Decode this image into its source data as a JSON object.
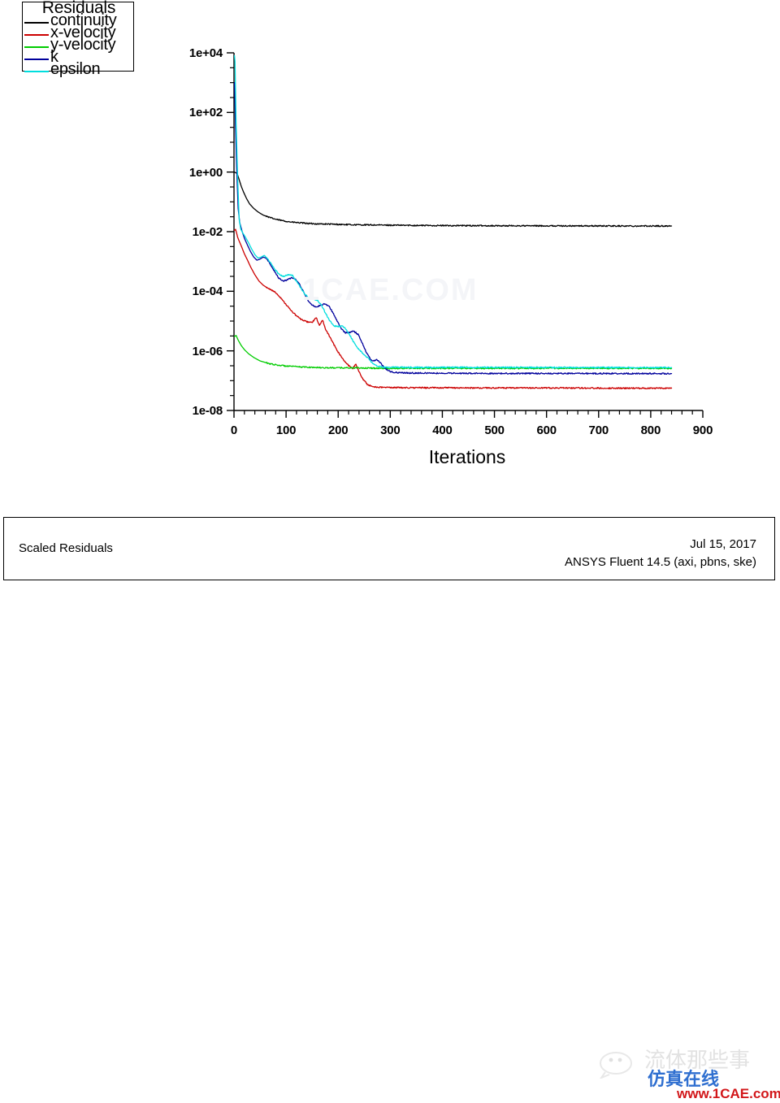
{
  "legend": {
    "title": "Residuals",
    "items": [
      {
        "label": "continuity",
        "color": "#000000"
      },
      {
        "label": "x-velocity",
        "color": "#cc0000"
      },
      {
        "label": "y-velocity",
        "color": "#00cc00"
      },
      {
        "label": "k",
        "color": "#00009c"
      },
      {
        "label": "epsilon",
        "color": "#00dede"
      }
    ]
  },
  "axes": {
    "y_labels": [
      "1e+04",
      "1e+02",
      "1e+00",
      "1e-02",
      "1e-04",
      "1e-06",
      "1e-08"
    ],
    "x_labels": [
      "0",
      "100",
      "200",
      "300",
      "400",
      "500",
      "600",
      "700",
      "800",
      "900"
    ],
    "x_title": "Iterations"
  },
  "info_bar": {
    "title": "Scaled Residuals",
    "date": "Jul 15, 2017",
    "solver": "ANSYS Fluent 14.5 (axi, pbns, ske)"
  },
  "watermarks": {
    "center": "1CAE.COM",
    "corner_cn_gray": "流体那些事",
    "corner_cn_blue": "仿真在线",
    "corner_url": "www.1CAE.com"
  },
  "chart_data": {
    "type": "line",
    "title": "Scaled Residuals",
    "xlabel": "Iterations",
    "ylabel": "",
    "xlim": [
      0,
      900
    ],
    "ylim": [
      1e-08,
      10000.0
    ],
    "yscale": "log",
    "grid": false,
    "legend_position": "top-left",
    "x_ticks": [
      0,
      100,
      200,
      300,
      400,
      500,
      600,
      700,
      800,
      900
    ],
    "x_minor_tick_step": 20,
    "y_ticks": [
      10000.0,
      100.0,
      1.0,
      0.01,
      0.0001,
      1e-06,
      1e-08
    ],
    "y_minor_ticks_per_decade_pair": 3,
    "data_x_end": 840,
    "series": [
      {
        "name": "continuity",
        "color": "#000000",
        "points": [
          [
            1,
            1.0
          ],
          [
            3,
            0.95
          ],
          [
            6,
            0.9
          ],
          [
            10,
            0.55
          ],
          [
            14,
            0.33
          ],
          [
            18,
            0.22
          ],
          [
            24,
            0.13
          ],
          [
            30,
            0.085
          ],
          [
            38,
            0.06
          ],
          [
            46,
            0.046
          ],
          [
            56,
            0.036
          ],
          [
            68,
            0.03
          ],
          [
            80,
            0.026
          ],
          [
            95,
            0.023
          ],
          [
            110,
            0.021
          ],
          [
            130,
            0.0195
          ],
          [
            150,
            0.0185
          ],
          [
            175,
            0.018
          ],
          [
            200,
            0.0175
          ],
          [
            230,
            0.017
          ],
          [
            260,
            0.0168
          ],
          [
            300,
            0.0165
          ],
          [
            350,
            0.0162
          ],
          [
            400,
            0.016
          ],
          [
            450,
            0.0159
          ],
          [
            500,
            0.0158
          ],
          [
            550,
            0.0157
          ],
          [
            600,
            0.0157
          ],
          [
            650,
            0.0156
          ],
          [
            700,
            0.0156
          ],
          [
            750,
            0.0155
          ],
          [
            800,
            0.0155
          ],
          [
            840,
            0.0155
          ]
        ]
      },
      {
        "name": "x-velocity",
        "color": "#cc0000",
        "points": [
          [
            1,
            0.011
          ],
          [
            3,
            0.012
          ],
          [
            5,
            0.009
          ],
          [
            7,
            0.0065
          ],
          [
            10,
            0.0048
          ],
          [
            14,
            0.0033
          ],
          [
            20,
            0.0018
          ],
          [
            26,
            0.0011
          ],
          [
            32,
            0.00065
          ],
          [
            40,
            0.00036
          ],
          [
            48,
            0.00022
          ],
          [
            56,
            0.00016
          ],
          [
            64,
            0.00013
          ],
          [
            72,
            0.00011
          ],
          [
            80,
            9e-05
          ],
          [
            90,
            6e-05
          ],
          [
            100,
            3.6e-05
          ],
          [
            110,
            2.2e-05
          ],
          [
            120,
            1.5e-05
          ],
          [
            130,
            1.1e-05
          ],
          [
            140,
            9.5e-06
          ],
          [
            150,
            9e-06
          ],
          [
            158,
            1.3e-05
          ],
          [
            164,
            7e-06
          ],
          [
            170,
            1.1e-05
          ],
          [
            176,
            5e-06
          ],
          [
            184,
            3e-06
          ],
          [
            192,
            1.6e-06
          ],
          [
            200,
            9e-07
          ],
          [
            210,
            5e-07
          ],
          [
            220,
            3.2e-07
          ],
          [
            228,
            2.6e-07
          ],
          [
            234,
            3.6e-07
          ],
          [
            240,
            2e-07
          ],
          [
            248,
            1.1e-07
          ],
          [
            256,
            7.5e-08
          ],
          [
            266,
            6.3e-08
          ],
          [
            280,
            6e-08
          ],
          [
            300,
            5.9e-08
          ],
          [
            340,
            5.8e-08
          ],
          [
            400,
            5.8e-08
          ],
          [
            460,
            5.7e-08
          ],
          [
            520,
            5.7e-08
          ],
          [
            580,
            5.7e-08
          ],
          [
            650,
            5.7e-08
          ],
          [
            720,
            5.6e-08
          ],
          [
            790,
            5.6e-08
          ],
          [
            840,
            5.6e-08
          ]
        ]
      },
      {
        "name": "y-velocity",
        "color": "#00cc00",
        "points": [
          [
            1,
            3e-06
          ],
          [
            4,
            3.3e-06
          ],
          [
            8,
            2.3e-06
          ],
          [
            14,
            1.5e-06
          ],
          [
            20,
            1.1e-06
          ],
          [
            28,
            8e-07
          ],
          [
            38,
            6e-07
          ],
          [
            50,
            4.6e-07
          ],
          [
            64,
            3.9e-07
          ],
          [
            80,
            3.4e-07
          ],
          [
            100,
            3.1e-07
          ],
          [
            125,
            2.9e-07
          ],
          [
            150,
            2.8e-07
          ],
          [
            180,
            2.7e-07
          ],
          [
            215,
            2.7e-07
          ],
          [
            250,
            2.65e-07
          ],
          [
            290,
            2.6e-07
          ],
          [
            340,
            2.6e-07
          ],
          [
            400,
            2.6e-07
          ],
          [
            460,
            2.6e-07
          ],
          [
            530,
            2.6e-07
          ],
          [
            600,
            2.6e-07
          ],
          [
            680,
            2.6e-07
          ],
          [
            760,
            2.6e-07
          ],
          [
            840,
            2.6e-07
          ]
        ]
      },
      {
        "name": "k",
        "color": "#00009c",
        "points": [
          [
            1,
            1000.0
          ],
          [
            3,
            30.0
          ],
          [
            5,
            1.5
          ],
          [
            8,
            0.06
          ],
          [
            11,
            0.02
          ],
          [
            15,
            0.011
          ],
          [
            20,
            0.006
          ],
          [
            26,
            0.0035
          ],
          [
            32,
            0.0021
          ],
          [
            38,
            0.0014
          ],
          [
            44,
            0.0011
          ],
          [
            50,
            0.0012
          ],
          [
            56,
            0.0014
          ],
          [
            62,
            0.0013
          ],
          [
            70,
            0.0008
          ],
          [
            78,
            0.00045
          ],
          [
            86,
            0.00028
          ],
          [
            94,
            0.00022
          ],
          [
            102,
            0.00024
          ],
          [
            110,
            0.00028
          ],
          [
            118,
            0.00026
          ],
          [
            126,
            0.00017
          ],
          [
            134,
            9e-05
          ],
          [
            142,
            5e-05
          ],
          [
            150,
            3.4e-05
          ],
          [
            158,
            3e-05
          ],
          [
            166,
            3.4e-05
          ],
          [
            174,
            3.8e-05
          ],
          [
            182,
            3.2e-05
          ],
          [
            190,
            1.9e-05
          ],
          [
            198,
            1e-05
          ],
          [
            206,
            5.5e-06
          ],
          [
            214,
            4e-06
          ],
          [
            222,
            4.2e-06
          ],
          [
            230,
            4.6e-06
          ],
          [
            238,
            3.6e-06
          ],
          [
            246,
            1.9e-06
          ],
          [
            254,
            9e-07
          ],
          [
            262,
            5.2e-07
          ],
          [
            268,
            4.6e-07
          ],
          [
            274,
            5.2e-07
          ],
          [
            280,
            4.2e-07
          ],
          [
            290,
            2.6e-07
          ],
          [
            300,
            2e-07
          ],
          [
            315,
            1.85e-07
          ],
          [
            335,
            1.8e-07
          ],
          [
            360,
            1.8e-07
          ],
          [
            400,
            1.78e-07
          ],
          [
            450,
            1.76e-07
          ],
          [
            510,
            1.75e-07
          ],
          [
            570,
            1.75e-07
          ],
          [
            640,
            1.74e-07
          ],
          [
            710,
            1.74e-07
          ],
          [
            780,
            1.73e-07
          ],
          [
            840,
            1.73e-07
          ]
        ]
      },
      {
        "name": "epsilon",
        "color": "#00dede",
        "points": [
          [
            1,
            8000.0
          ],
          [
            2,
            5000.0
          ],
          [
            4,
            50.0
          ],
          [
            7,
            0.6
          ],
          [
            10,
            0.025
          ],
          [
            13,
            0.012
          ],
          [
            17,
            0.009
          ],
          [
            22,
            0.0065
          ],
          [
            28,
            0.0042
          ],
          [
            34,
            0.0026
          ],
          [
            40,
            0.0017
          ],
          [
            46,
            0.0013
          ],
          [
            52,
            0.0014
          ],
          [
            58,
            0.0016
          ],
          [
            64,
            0.0013
          ],
          [
            72,
            0.0008
          ],
          [
            80,
            0.0005
          ],
          [
            88,
            0.00035
          ],
          [
            96,
            0.00032
          ],
          [
            104,
            0.00036
          ],
          [
            112,
            0.00034
          ],
          [
            120,
            0.00022
          ],
          [
            128,
            0.00013
          ],
          [
            136,
            8e-05
          ],
          [
            144,
            6e-05
          ],
          [
            152,
            5.5e-05
          ],
          [
            160,
            5e-05
          ],
          [
            168,
            3.4e-05
          ],
          [
            176,
            1.8e-05
          ],
          [
            184,
            1e-05
          ],
          [
            192,
            7e-06
          ],
          [
            200,
            6.5e-06
          ],
          [
            208,
            6.8e-06
          ],
          [
            216,
            5.2e-06
          ],
          [
            224,
            3e-06
          ],
          [
            232,
            1.7e-06
          ],
          [
            240,
            1.1e-06
          ],
          [
            248,
            8e-07
          ],
          [
            256,
            6e-07
          ],
          [
            264,
            4.2e-07
          ],
          [
            272,
            3.2e-07
          ],
          [
            282,
            2.9e-07
          ],
          [
            295,
            2.85e-07
          ],
          [
            315,
            2.8e-07
          ],
          [
            340,
            2.8e-07
          ],
          [
            380,
            2.8e-07
          ],
          [
            430,
            2.8e-07
          ],
          [
            490,
            2.78e-07
          ],
          [
            550,
            2.78e-07
          ],
          [
            620,
            2.77e-07
          ],
          [
            700,
            2.77e-07
          ],
          [
            780,
            2.76e-07
          ],
          [
            840,
            2.76e-07
          ]
        ]
      }
    ]
  }
}
